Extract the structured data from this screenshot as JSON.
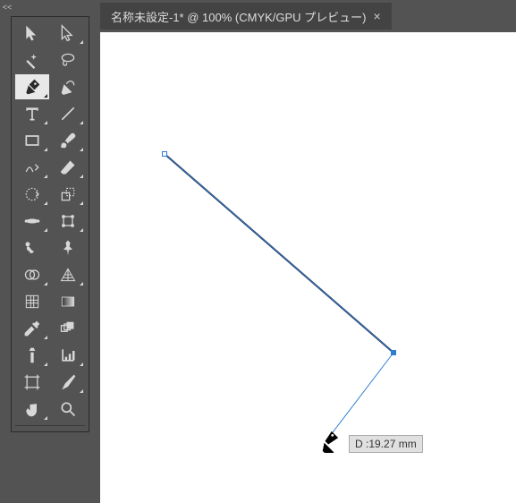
{
  "tab": {
    "title": "名称未設定-1* @ 100% (CMYK/GPU プレビュー)"
  },
  "measure": {
    "label": "D :19.27 mm"
  },
  "tools": {
    "selection": "選択ツール",
    "direct": "ダイレクト選択ツール",
    "wand": "自動選択ツール",
    "lasso": "なげなわツール",
    "pen": "ペンツール",
    "curvature": "曲線ツール",
    "type": "文字ツール",
    "line": "直線ツール",
    "rect": "長方形ツール",
    "brush": "ブラシツール",
    "shaper": "Shaperツール",
    "eraser": "消しゴムツール",
    "rotate": "回転ツール",
    "scale": "拡大縮小ツール",
    "width": "線幅ツール",
    "free": "自由変形ツール",
    "puppet": "パペットワープツール",
    "pin": "押しピン",
    "builder": "シェイプ形成ツール",
    "perspective": "遠近グリッドツール",
    "mesh": "メッシュツール",
    "gradient": "グラデーションツール",
    "eyedrop": "スポイトツール",
    "blend": "ブレンドツール",
    "symbol": "シンボルスプレーツール",
    "graph": "棒グラフツール",
    "artboard": "アートボードツール",
    "slice": "スライスツール",
    "hand": "手のひらツール",
    "zoom": "ズームツール"
  }
}
